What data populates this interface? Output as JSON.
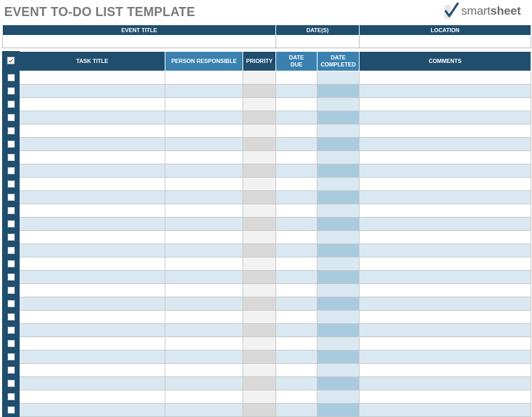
{
  "header": {
    "title": "EVENT TO-DO LIST TEMPLATE",
    "logo_text_light": "smart",
    "logo_text_bold": "sheet"
  },
  "info_table": {
    "event_title_label": "EVENT TITLE",
    "dates_label": "DATE(S)",
    "location_label": "LOCATION",
    "event_title_value": "",
    "dates_value": "",
    "location_value": ""
  },
  "task_table": {
    "columns": {
      "task_title": "TASK TITLE",
      "person_responsible": "PERSON RESPONSIBLE",
      "priority": "PRIORITY",
      "date_due_line1": "DATE",
      "date_due_line2": "DUE",
      "date_completed_line1": "DATE",
      "date_completed_line2": "COMPLETED",
      "comments": "COMMENTS"
    },
    "row_count": 26,
    "rows": []
  },
  "colors": {
    "header_dark": "#1f4e6e",
    "header_mid": "#3a81b0",
    "band_light": "#dae8f1",
    "band_mid": "#a9cbe0",
    "priority_light": "#f2f2f2",
    "priority_dark": "#d9d9d9",
    "title_gray": "#7a7a7a"
  },
  "icons": {
    "logo": "smartsheet-checkmark-icon",
    "header_checkbox": "checked-checkbox-icon",
    "row_checkbox": "checkbox-icon"
  }
}
